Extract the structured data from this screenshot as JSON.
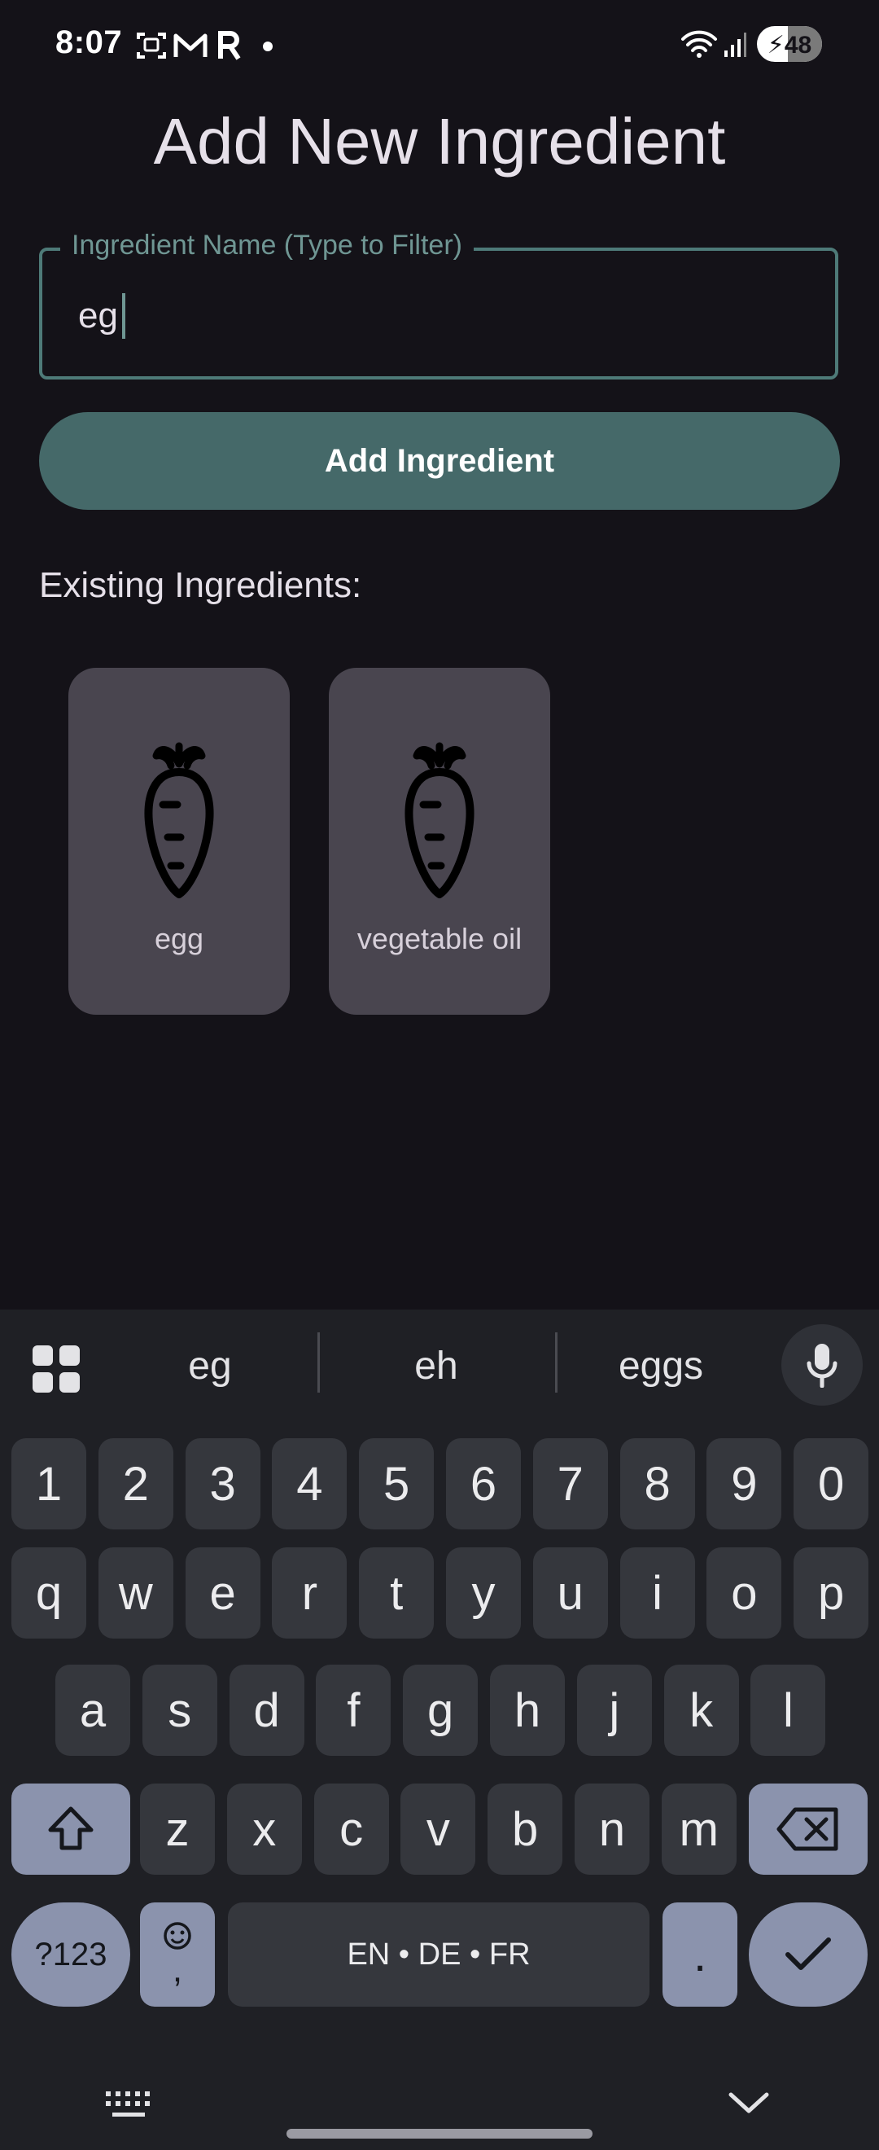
{
  "status_bar": {
    "time": "8:07",
    "notification_icons": [
      "screenshot-icon",
      "gmail-icon",
      "r-app-icon",
      "dot-icon"
    ],
    "system_icons": [
      "wifi-icon",
      "cell-signal-icon",
      "battery-icon"
    ],
    "battery_level": "48",
    "battery_fraction": 0.48,
    "charging": true
  },
  "page": {
    "title": "Add New Ingredient"
  },
  "ingredient_field": {
    "label": "Ingredient Name (Type to Filter)",
    "value": "eg"
  },
  "add_button": {
    "label": "Add Ingredient"
  },
  "existing": {
    "heading": "Existing Ingredients:",
    "items": [
      {
        "label": "egg",
        "icon": "carrot-icon"
      },
      {
        "label": "vegetable oil",
        "icon": "carrot-icon"
      }
    ]
  },
  "keyboard": {
    "suggestions": [
      "eg",
      "eh",
      "eggs"
    ],
    "row_numbers": [
      "1",
      "2",
      "3",
      "4",
      "5",
      "6",
      "7",
      "8",
      "9",
      "0"
    ],
    "row_top": [
      "q",
      "w",
      "e",
      "r",
      "t",
      "y",
      "u",
      "i",
      "o",
      "p"
    ],
    "row_middle": [
      "a",
      "s",
      "d",
      "f",
      "g",
      "h",
      "j",
      "k",
      "l"
    ],
    "row_bottom": [
      "z",
      "x",
      "c",
      "v",
      "b",
      "n",
      "m"
    ],
    "symbols_label": "?123",
    "comma_label": ",",
    "space_label": "EN • DE • FR",
    "period_label": ".",
    "icons": [
      "apps-grid-icon",
      "mic-icon",
      "shift-icon",
      "backspace-icon",
      "emoji-icon",
      "enter-check-icon",
      "keyboard-switch-icon",
      "collapse-chevron-icon"
    ]
  },
  "colors": {
    "background": "#141218",
    "accent": "#456969",
    "field_outline": "#4e7a78",
    "card": "#49454f",
    "keyboard_bg": "#1f2025",
    "key": "#35373d",
    "mod_key": "#8b93ad"
  }
}
